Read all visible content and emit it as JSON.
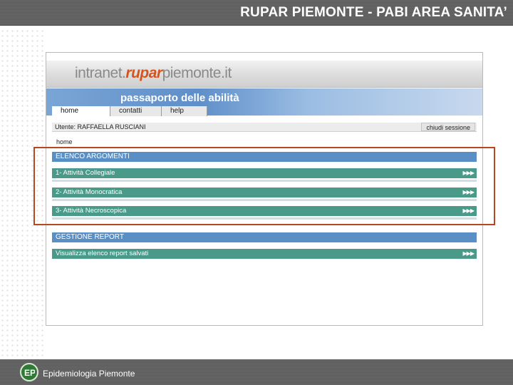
{
  "slide": {
    "title": "RUPAR PIEMONTE  - PABI AREA SANITA’",
    "footer_text": "Epidemiologia Piemonte",
    "logo_text": "EP"
  },
  "browser": {
    "brand_prefix": "intranet.",
    "brand_strong": "rupar",
    "brand_suffix": "piemonte.it",
    "banner_title": "passaporto delle abilità",
    "tabs": [
      {
        "label": "home"
      },
      {
        "label": "contatti"
      },
      {
        "label": "help"
      }
    ],
    "user_line": "Utente: RAFFAELLA RUSCIANI",
    "logout_label": "chiudi sessione",
    "breadcrumb": "home",
    "section1_title": "ELENCO ARGOMENTI",
    "items": [
      {
        "label": "1- Attività Collegiale",
        "arrows": "▶▶▶"
      },
      {
        "label": "2- Attività Monocratica",
        "arrows": "▶▶▶"
      },
      {
        "label": "3- Attività Necroscopica",
        "arrows": "▶▶▶"
      }
    ],
    "section2_title": "GESTIONE REPORT",
    "report_item": {
      "label": "Visualizza elenco report salvati",
      "arrows": "▶▶▶"
    }
  },
  "colors": {
    "section_blue": "#5a8fc6",
    "item_teal": "#4a9a8a",
    "highlight": "#b8461f",
    "brand_orange": "#d4541c"
  }
}
